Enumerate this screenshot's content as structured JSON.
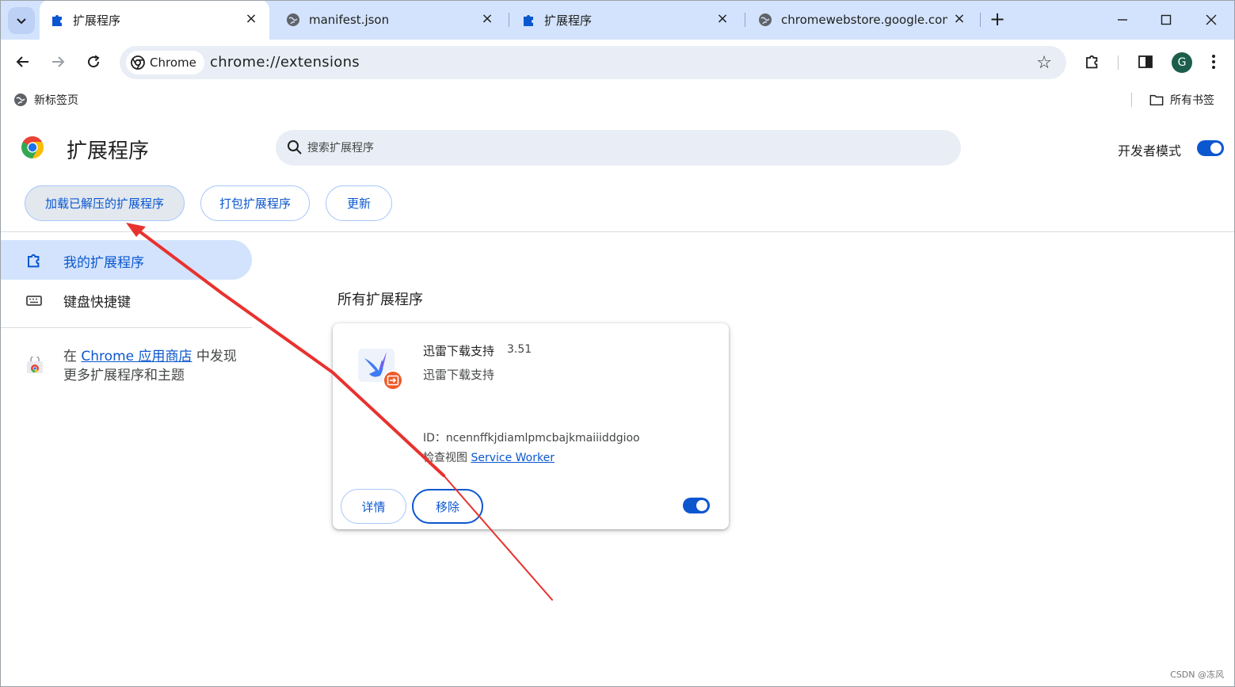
{
  "tabs": [
    {
      "title": "扩展程序",
      "icon": "puzzle-icon",
      "active": true
    },
    {
      "title": "manifest.json",
      "icon": "globe-icon",
      "active": false
    },
    {
      "title": "扩展程序",
      "icon": "puzzle-icon",
      "active": false
    },
    {
      "title": "chromewebstore.google.com",
      "icon": "globe-icon",
      "active": false
    }
  ],
  "toolbar": {
    "chip_label": "Chrome",
    "url": "chrome://extensions"
  },
  "bookmarks": {
    "left_item": "新标签页",
    "right_item": "所有书签"
  },
  "account": {
    "initial": "G",
    "color": "#1b5e4b"
  },
  "page": {
    "title": "扩展程序",
    "search_placeholder": "搜索扩展程序",
    "dev_mode_label": "开发者模式",
    "dev_mode_on": true
  },
  "dev_buttons": {
    "load_unpacked": "加载已解压的扩展程序",
    "pack": "打包扩展程序",
    "update": "更新"
  },
  "sidebar": {
    "items": [
      {
        "label": "我的扩展程序",
        "icon": "extensions-icon",
        "selected": true
      },
      {
        "label": "键盘快捷键",
        "icon": "keyboard-icon",
        "selected": false
      }
    ],
    "promo_prefix": "在 ",
    "promo_link": "Chrome 应用商店",
    "promo_suffix": " 中发现",
    "promo_line2": "更多扩展程序和主题"
  },
  "main": {
    "section_title": "所有扩展程序",
    "extension": {
      "name": "迅雷下载支持",
      "version": "3.51",
      "description": "迅雷下载支持",
      "id_text": "ID：ncennffkjdiamlpmcbajkmaiiiddgioo",
      "inspect_label": "检查视图 ",
      "inspect_link": "Service Worker",
      "details_button": "详情",
      "remove_button": "移除",
      "enabled": true
    }
  },
  "watermark": "CSDN @冻风",
  "colors": {
    "accent": "#0b57d0",
    "tab_strip": "#d3e3fd",
    "annotation_arrow": "#e8322f"
  }
}
